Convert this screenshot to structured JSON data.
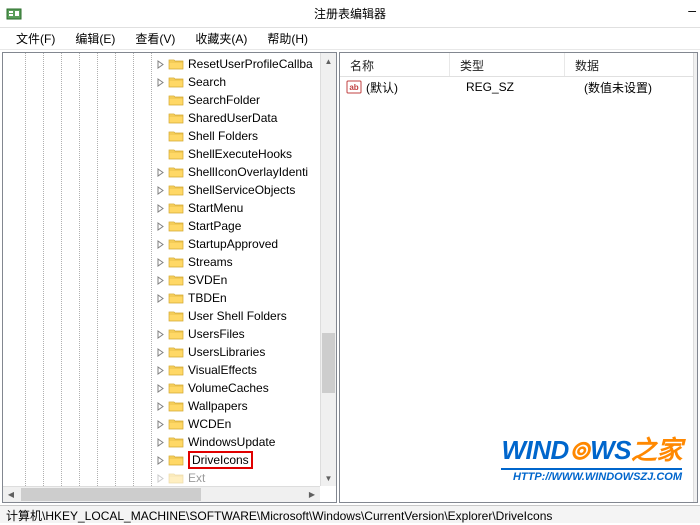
{
  "window": {
    "title": "注册表编辑器",
    "minimize": "–",
    "close": "×"
  },
  "menu": {
    "file": "文件(F)",
    "edit": "编辑(E)",
    "view": "查看(V)",
    "favorites": "收藏夹(A)",
    "help": "帮助(H)"
  },
  "tree": {
    "items": [
      {
        "label": "ResetUserProfileCallba",
        "expandable": true
      },
      {
        "label": "Search",
        "expandable": true
      },
      {
        "label": "SearchFolder",
        "expandable": false
      },
      {
        "label": "SharedUserData",
        "expandable": false
      },
      {
        "label": "Shell Folders",
        "expandable": false
      },
      {
        "label": "ShellExecuteHooks",
        "expandable": false
      },
      {
        "label": "ShellIconOverlayIdenti",
        "expandable": true
      },
      {
        "label": "ShellServiceObjects",
        "expandable": true
      },
      {
        "label": "StartMenu",
        "expandable": true
      },
      {
        "label": "StartPage",
        "expandable": true
      },
      {
        "label": "StartupApproved",
        "expandable": true
      },
      {
        "label": "Streams",
        "expandable": true
      },
      {
        "label": "SVDEn",
        "expandable": true
      },
      {
        "label": "TBDEn",
        "expandable": true
      },
      {
        "label": "User Shell Folders",
        "expandable": false
      },
      {
        "label": "UsersFiles",
        "expandable": true
      },
      {
        "label": "UsersLibraries",
        "expandable": true
      },
      {
        "label": "VisualEffects",
        "expandable": true
      },
      {
        "label": "VolumeCaches",
        "expandable": true
      },
      {
        "label": "Wallpapers",
        "expandable": true
      },
      {
        "label": "WCDEn",
        "expandable": true
      },
      {
        "label": "WindowsUpdate",
        "expandable": true
      },
      {
        "label": "DriveIcons",
        "expandable": true,
        "highlighted": true
      },
      {
        "label": "Ext",
        "expandable": true,
        "partial": true
      }
    ]
  },
  "list": {
    "headers": {
      "name": "名称",
      "type": "类型",
      "data": "数据"
    },
    "rows": [
      {
        "name": "(默认)",
        "type": "REG_SZ",
        "data": "(数值未设置)"
      }
    ]
  },
  "statusbar": {
    "path": "计算机\\HKEY_LOCAL_MACHINE\\SOFTWARE\\Microsoft\\Windows\\CurrentVersion\\Explorer\\DriveIcons"
  },
  "watermark": {
    "text1": "WIND",
    "text2": "WS",
    "text3": "之家",
    "url": "HTTP://WWW.WINDOWSZJ.COM"
  }
}
